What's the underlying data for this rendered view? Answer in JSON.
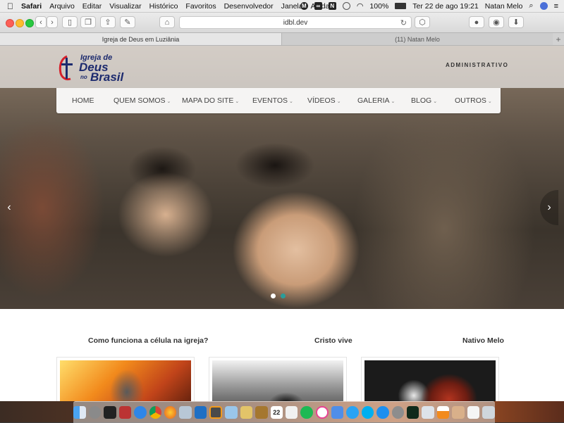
{
  "menubar": {
    "app": "Safari",
    "items": [
      "Arquivo",
      "Editar",
      "Visualizar",
      "Histórico",
      "Favoritos",
      "Desenvolvedor",
      "Janela",
      "Ajuda"
    ],
    "battery": "100%",
    "clock": "Ter 22 de ago  19:21",
    "user": "Natan Melo"
  },
  "browser": {
    "url": "idbl.dev",
    "tabs": [
      {
        "title": "Igreja de Deus em Luziânia"
      },
      {
        "title": "(11) Natan Melo"
      }
    ]
  },
  "site": {
    "logo": {
      "line1": "Igreja de",
      "line2": "Deus",
      "line3": "no",
      "line4": "Brasil"
    },
    "admin_link": "ADMINISTRATIVO",
    "nav": [
      {
        "label": "HOME",
        "has_menu": false
      },
      {
        "label": "QUEM SOMOS",
        "has_menu": true
      },
      {
        "label": "MAPA DO SITE",
        "has_menu": true
      },
      {
        "label": "EVENTOS",
        "has_menu": true
      },
      {
        "label": "VÍDEOS",
        "has_menu": true
      },
      {
        "label": "GALERIA",
        "has_menu": true
      },
      {
        "label": "BLOG",
        "has_menu": true
      },
      {
        "label": "OUTROS",
        "has_menu": true
      }
    ],
    "slider": {
      "prev": "‹",
      "next": "›",
      "slides": 2,
      "active": 1
    },
    "sections": [
      {
        "title": "Como funciona a célula na igreja?"
      },
      {
        "title": "Cristo vive"
      },
      {
        "title": "Nativo Melo"
      }
    ]
  },
  "dock": {
    "icons": [
      "finder-icon",
      "launchpad-icon",
      "terminal-icon",
      "photo-booth-icon",
      "safari-icon",
      "chrome-icon",
      "firefox-icon",
      "elephant-icon",
      "vscode-icon",
      "sublime-icon",
      "cube-icon",
      "database-icon",
      "notes-icon",
      "calendar-icon",
      "list-icon",
      "spotify-icon",
      "itunes-icon",
      "music-icon",
      "chat-icon",
      "skype-icon",
      "app-store-icon",
      "preferences-icon",
      "activity-icon",
      "preview-icon",
      "vlc-icon",
      "photos-icon",
      "document-icon",
      "trash-icon"
    ],
    "calendar_day": "22"
  }
}
